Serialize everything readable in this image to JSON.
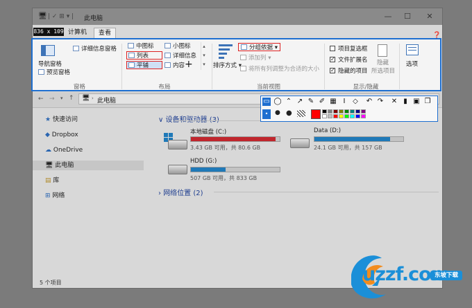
{
  "window": {
    "title": "此电脑",
    "title_prefix": "| ✓ ⊞ ▾ |",
    "controls": [
      "—",
      "☐",
      "✕"
    ],
    "size_badge": "836 x 109"
  },
  "tabs": [
    {
      "label": "计算机"
    },
    {
      "label": "查看"
    }
  ],
  "ribbon": {
    "panes": {
      "nav_pane": "导航窗格",
      "preview_pane": "预览窗格",
      "details_pane": "详细信息窗格",
      "group": "窗格"
    },
    "layout": {
      "medium": "中图标",
      "small": "小图标",
      "list": "列表",
      "details": "详细信息",
      "tiles": "平铺",
      "content": "内容",
      "group": "布局"
    },
    "current_view": {
      "sort_by": "排序方式",
      "group_by": "分组依据",
      "add_column": "添加列",
      "fit_columns": "将所有列调整为合适的大小",
      "group": "当前视图"
    },
    "show_hide": {
      "item_checkbox": "项目复选框",
      "ext": "文件扩展名",
      "hidden_items": "隐藏的项目",
      "hide_selected": "隐藏",
      "hide_selected_2": "所选项目",
      "group": "显示/隐藏"
    },
    "options": "选项"
  },
  "address": {
    "path": "此电脑"
  },
  "nav": {
    "items": [
      "快速访问",
      "Dropbox",
      "OneDrive",
      "此电脑",
      "库",
      "网络"
    ]
  },
  "content": {
    "devices_title": "设备和驱动器 (3)",
    "network_title": "网络位置 (2)",
    "drives": [
      {
        "name": "本地磁盘 (C:)",
        "info": "3.43 GB 可用，共 80.6 GB",
        "used_fraction": 0.957,
        "color": "#c0262d"
      },
      {
        "name": "Data (D:)",
        "info": "24.1 GB 可用，共 157 GB",
        "used_fraction": 0.85,
        "color": "#1f79b8"
      },
      {
        "name": "HDD (G:)",
        "info": "507 GB 可用，共 833 GB",
        "used_fraction": 0.39,
        "color": "#1f79b8"
      }
    ]
  },
  "status": {
    "count": "5 个项目"
  },
  "logo": {
    "brand": "uzzf.com",
    "tag": "东坡下载"
  },
  "colors": {
    "accent": "#1e6fd0",
    "highlight_red": "#dd2222"
  }
}
